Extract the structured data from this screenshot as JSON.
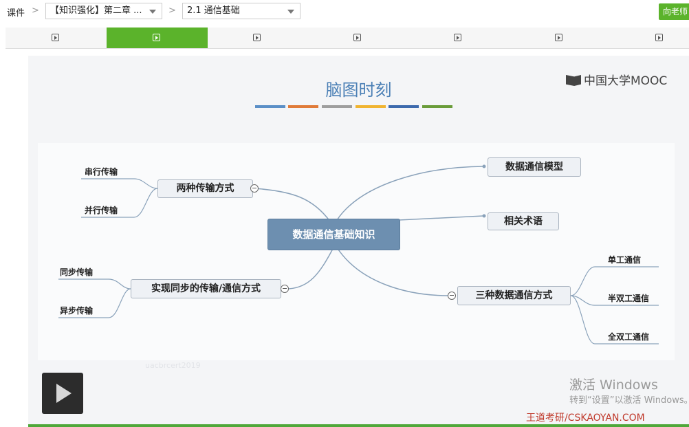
{
  "header": {
    "breadcrumb_root": "课件",
    "chapter_select": "【知识强化】第二章 ...",
    "section_select": "2.1 通信基础",
    "ask_teacher_button": "向老师"
  },
  "tabs": [
    {
      "icon": "play-icon",
      "active": false
    },
    {
      "icon": "play-icon",
      "active": true
    },
    {
      "icon": "play-icon",
      "active": false
    },
    {
      "icon": "play-icon",
      "active": false
    },
    {
      "icon": "play-icon",
      "active": false
    },
    {
      "icon": "play-icon",
      "active": false
    },
    {
      "icon": "play-icon",
      "active": false
    }
  ],
  "video": {
    "title": "脑图时刻",
    "logo_text": "中国大学MOOC",
    "color_bars": [
      "#5b8fc7",
      "#e07b39",
      "#9e9e9e",
      "#f0b431",
      "#3d6aad",
      "#6a9c3a"
    ],
    "mindmap": {
      "center": "数据通信基础知识",
      "left_branches": [
        {
          "label": "两种传输方式",
          "children": [
            "串行传输",
            "并行传输"
          ]
        },
        {
          "label": "实现同步的传输/通信方式",
          "children": [
            "同步传输",
            "异步传输"
          ]
        }
      ],
      "right_branches": [
        {
          "label": "数据通信模型",
          "children": []
        },
        {
          "label": "相关术语",
          "children": []
        },
        {
          "label": "三种数据通信方式",
          "children": [
            "单工通信",
            "半双工通信",
            "全双工通信"
          ]
        }
      ]
    },
    "faint_watermark": "uacbrcert2019",
    "windows_activation": {
      "line1": "激活 Windows",
      "line2": "转到“设置”以激活 Windows。"
    },
    "site_watermark": "王道考研/CSKAOYAN.COM"
  },
  "colors": {
    "accent_green": "#5bb32b",
    "center_node": "#6d8fb0",
    "title_blue": "#4a7fb5",
    "watermark_red": "#c0392b"
  }
}
